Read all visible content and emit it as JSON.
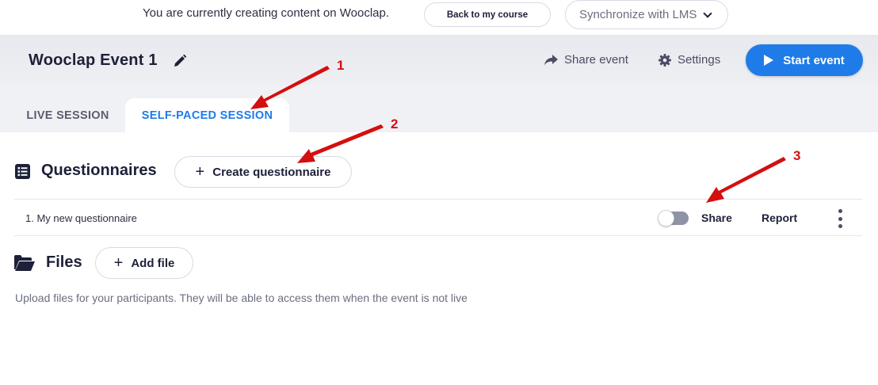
{
  "banner": {
    "text": "You are currently creating content on Wooclap.",
    "back_button": "Back to my course",
    "sync_select": "Synchronize with LMS"
  },
  "header": {
    "event_title": "Wooclap Event 1",
    "share_event": "Share event",
    "settings": "Settings",
    "start_event": "Start event"
  },
  "tabs": [
    {
      "label": "LIVE SESSION",
      "active": false
    },
    {
      "label": "SELF-PACED SESSION",
      "active": true
    }
  ],
  "questionnaires": {
    "title": "Questionnaires",
    "create_button": "Create questionnaire",
    "items": [
      {
        "name": "1.  My new questionnaire",
        "share_label": "Share",
        "report_label": "Report",
        "enabled": false
      }
    ]
  },
  "files": {
    "title": "Files",
    "add_button": "Add file",
    "description": "Upload files for your participants. They will be able to access them when the event is not live"
  },
  "annotations": [
    "1",
    "2",
    "3"
  ],
  "colors": {
    "accent": "#1f7be8",
    "annotation": "#d40f0f",
    "text_dark": "#1d2038"
  },
  "icons": [
    "pencil-icon",
    "share-arrow-icon",
    "gear-icon",
    "play-icon",
    "list-icon",
    "plus-icon",
    "folder-icon",
    "kebab-menu-icon",
    "chevron-down-icon"
  ]
}
